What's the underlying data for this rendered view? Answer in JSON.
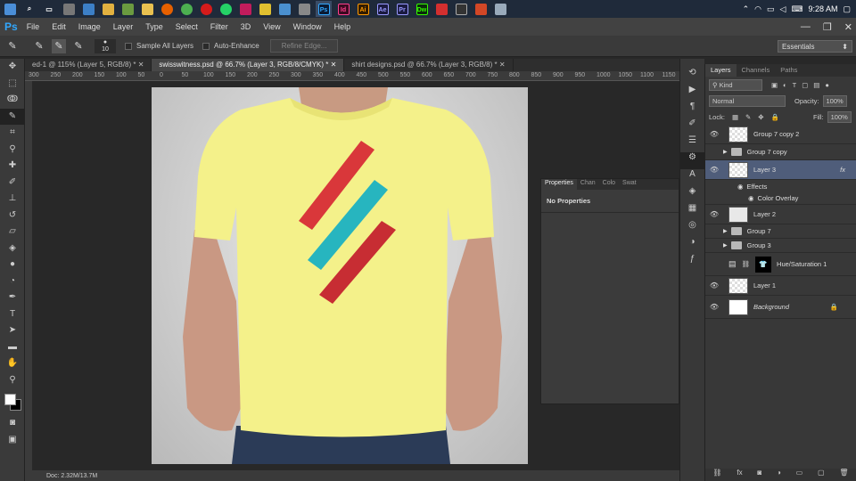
{
  "taskbar": {
    "icons": [
      "search-icon",
      "task-view-icon",
      "store-icon",
      "explorer-icon",
      "paint-icon",
      "minecraft-icon",
      "firefox-icon",
      "chrome-icon",
      "opera-icon",
      "whatsapp-icon",
      "app-icon",
      "bulb-icon",
      "box-icon",
      "pen-icon"
    ],
    "apps": [
      {
        "label": "Ps",
        "color": "#31a8ff",
        "bg": "#0a1a33"
      },
      {
        "label": "Id",
        "color": "#ff3f8d",
        "bg": "#3b0a20"
      },
      {
        "label": "Ai",
        "color": "#ff9a00",
        "bg": "#331c00"
      },
      {
        "label": "Ae",
        "color": "#9999ff",
        "bg": "#1a1a40"
      },
      {
        "label": "Pr",
        "color": "#9999ff",
        "bg": "#1a1a40"
      },
      {
        "label": "Dw",
        "color": "#35fa00",
        "bg": "#0a2a0a"
      }
    ],
    "time": "9:28 AM"
  },
  "menubar": {
    "logo": "Ps",
    "items": [
      "File",
      "Edit",
      "Image",
      "Layer",
      "Type",
      "Select",
      "Filter",
      "3D",
      "View",
      "Window",
      "Help"
    ]
  },
  "options": {
    "brush_size": "10",
    "sample_all": "Sample All Layers",
    "auto_enhance": "Auto-Enhance",
    "refine": "Refine Edge...",
    "workspace": "Essentials"
  },
  "tabs": [
    {
      "label": "ed-1 @ 115% (Layer 5, RGB/8) *",
      "active": false
    },
    {
      "label": "swisswitness.psd @ 66.7% (Layer 3, RGB/8/CMYK) *",
      "active": true
    },
    {
      "label": "shirt designs.psd @ 66.7% (Layer 3, RGB/8) *",
      "active": false
    }
  ],
  "ruler": [
    "300",
    "250",
    "200",
    "150",
    "100",
    "50",
    "0",
    "50",
    "100",
    "150",
    "200",
    "250",
    "300",
    "350",
    "400",
    "450",
    "500",
    "550",
    "600",
    "650",
    "700",
    "750",
    "800",
    "850",
    "900",
    "950",
    "1000",
    "1050",
    "1100",
    "1150",
    "1200"
  ],
  "status": {
    "doc": "Doc: 2.32M/13.7M"
  },
  "properties": {
    "tabs": [
      "Properties",
      "Chan",
      "Colo",
      "Swat"
    ],
    "text": "No Properties"
  },
  "layers": {
    "tabs": [
      "Layers",
      "Channels",
      "Paths"
    ],
    "kind": "Kind",
    "blend": "Normal",
    "opacity_label": "Opacity:",
    "opacity": "100%",
    "lock_label": "Lock:",
    "fill_label": "Fill:",
    "fill": "100%",
    "rows": [
      {
        "name": "Group 7 copy 2",
        "type": "layer",
        "eye": true
      },
      {
        "name": "Group 7 copy",
        "type": "group",
        "eye": false
      },
      {
        "name": "Layer 3",
        "type": "layer",
        "eye": true,
        "selected": true,
        "fx": "fx"
      },
      {
        "name": "Effects",
        "type": "effect"
      },
      {
        "name": "Color Overlay",
        "type": "effect2"
      },
      {
        "name": "Layer 2",
        "type": "layer",
        "eye": true
      },
      {
        "name": "Group 7",
        "type": "group",
        "eye": false
      },
      {
        "name": "Group 3",
        "type": "group",
        "eye": false
      },
      {
        "name": "Hue/Saturation 1",
        "type": "adj",
        "eye": false
      },
      {
        "name": "Layer 1",
        "type": "layer",
        "eye": true
      },
      {
        "name": "Background",
        "type": "bg",
        "eye": true
      }
    ]
  },
  "colors": {
    "shirt": "#f4f18a",
    "red": "#d9373a",
    "teal": "#27b5bf",
    "accent": "#31a8ff"
  }
}
